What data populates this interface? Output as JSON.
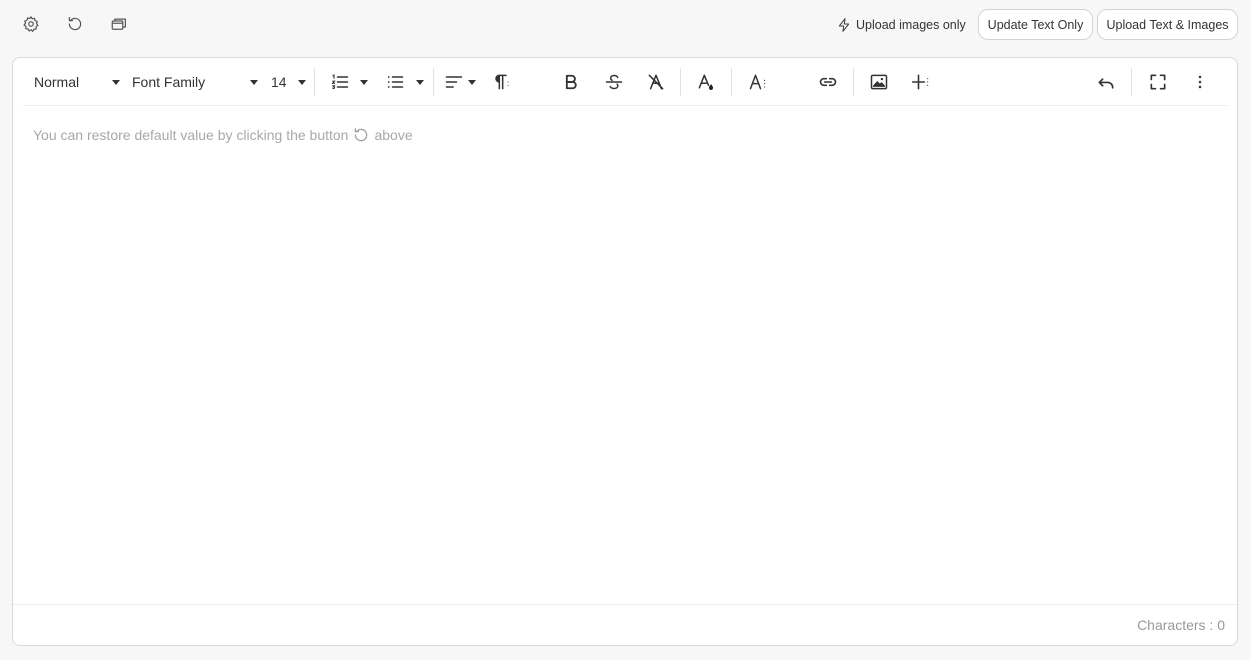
{
  "topbar": {
    "icons": [
      "gear-icon",
      "restore-icon",
      "preview-icon"
    ],
    "upload_images_only_label": "Upload images only",
    "update_text_only_label": "Update Text Only",
    "upload_text_images_label": "Upload Text & Images"
  },
  "toolbar": {
    "paragraph_style": "Normal",
    "font_family": "Font Family",
    "font_size": "14",
    "icons": [
      "ordered-list-icon",
      "unordered-list-icon",
      "align-left-icon",
      "paragraph-icon",
      "bold-icon",
      "strikethrough-icon",
      "clear-format-icon",
      "text-color-icon",
      "font-size-options-icon",
      "link-icon",
      "image-icon",
      "insert-more-icon",
      "undo-icon",
      "fullscreen-icon",
      "more-vertical-icon"
    ]
  },
  "editor": {
    "placeholder_before": "You can restore default value by clicking the button",
    "placeholder_after": "above"
  },
  "footer": {
    "characters_label": "Characters : 0"
  }
}
